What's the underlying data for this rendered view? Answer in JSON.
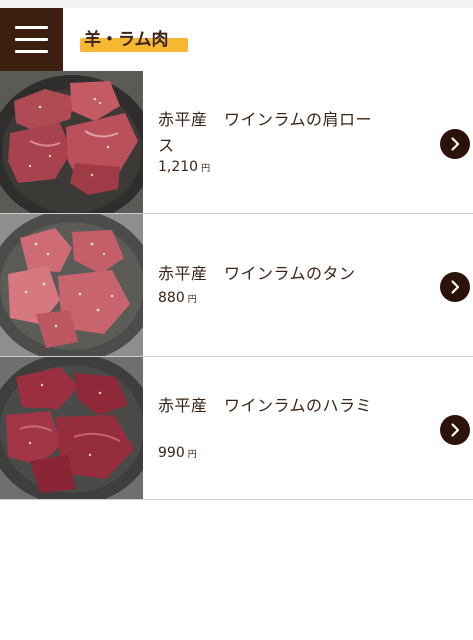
{
  "header": {
    "category_title": "羊・ラム肉",
    "menu_icon": "hamburger-menu-icon"
  },
  "items": [
    {
      "name": "赤平産　ワインラムの肩ロース",
      "price": "1,210",
      "currency": "円",
      "icon": "chevron-right-icon"
    },
    {
      "name": "赤平産　ワインラムのタン",
      "price": "880",
      "currency": "円",
      "icon": "chevron-right-icon"
    },
    {
      "name": "赤平産　ワインラムのハラミ",
      "price": "990",
      "currency": "円",
      "icon": "chevron-right-icon"
    }
  ],
  "colors": {
    "menu_bg": "#3d1f0f",
    "highlight": "#f6b733",
    "text": "#3a2418",
    "chevron_bg": "#2b1309"
  }
}
